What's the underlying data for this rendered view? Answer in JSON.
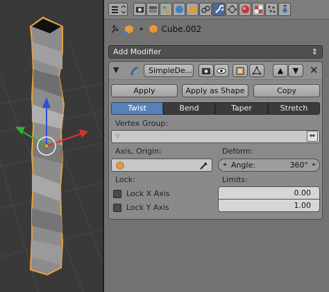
{
  "breadcrumb": {
    "object_name": "Cube.002"
  },
  "add_modifier_label": "Add Modifier",
  "modifier": {
    "name": "SimpleDe...",
    "apply_label": "Apply",
    "apply_shape_label": "Apply as Shape ...",
    "copy_label": "Copy",
    "modes": [
      "Twist",
      "Bend",
      "Taper",
      "Stretch"
    ],
    "active_mode": "Twist",
    "vertex_group_label": "Vertex Group:",
    "vertex_group_value": "",
    "axis_origin_label": "Axis, Origin:",
    "deform_label": "Deform:",
    "angle_label": "Angle:",
    "angle_value": "360°",
    "lock_label": "Lock:",
    "lock_x_label": "Lock X Axis",
    "lock_y_label": "Lock Y Axis",
    "lock_x_checked": false,
    "lock_y_checked": false,
    "limits_label": "Limits:",
    "limit_min": "0.00",
    "limit_max": "1.00"
  },
  "colors": {
    "panel_bg": "#727272",
    "active_tab": "#5681b9",
    "object_outline": "#e8a23c",
    "axis_x": "#e03030",
    "axis_y": "#2fb52f",
    "axis_z": "#2e4fd8"
  },
  "icons": [
    "properties-editor-icon",
    "render-icon",
    "layers-icon",
    "scene-icon",
    "world-icon",
    "object-icon",
    "constraints-icon",
    "modifier-wrench-icon",
    "material-icon",
    "texture-icon",
    "particles-icon",
    "physics-icon"
  ]
}
